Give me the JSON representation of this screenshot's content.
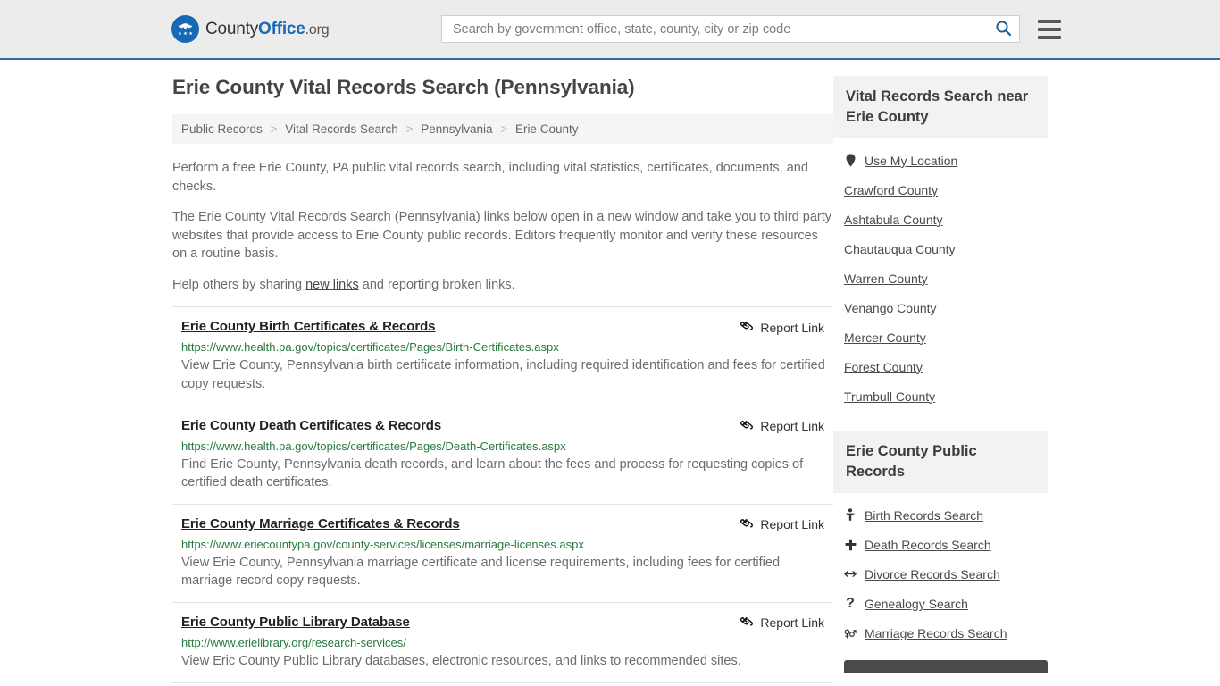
{
  "header": {
    "logo": {
      "icon": "eagle-seal-icon",
      "part1": "County",
      "part2": "Office",
      "part3": ".org"
    },
    "search": {
      "placeholder": "Search by government office, state, county, city or zip code",
      "value": "",
      "search_icon": "search-icon"
    },
    "menu_icon": "hamburger-menu-icon"
  },
  "main": {
    "title": "Erie County Vital Records Search (Pennsylvania)",
    "breadcrumb": [
      "Public Records",
      "Vital Records Search",
      "Pennsylvania",
      "Erie County"
    ],
    "breadcrumb_separator": ">",
    "intro_1": "Perform a free Erie County, PA public vital records search, including vital statistics, certificates, documents, and checks.",
    "intro_2": "The Erie County Vital Records Search (Pennsylvania) links below open in a new window and take you to third party websites that provide access to Erie County public records. Editors frequently monitor and verify these resources on a routine basis.",
    "intro_3_pre": "Help others by sharing ",
    "intro_3_link": "new links",
    "intro_3_post": " and reporting broken links.",
    "report_link_label": "Report Link",
    "report_link_icon": "broken-link-icon",
    "results": [
      {
        "title": "Erie County Birth Certificates & Records",
        "url": "https://www.health.pa.gov/topics/certificates/Pages/Birth-Certificates.aspx",
        "description": "View Erie County, Pennsylvania birth certificate information, including required identification and fees for certified copy requests."
      },
      {
        "title": "Erie County Death Certificates & Records",
        "url": "https://www.health.pa.gov/topics/certificates/Pages/Death-Certificates.aspx",
        "description": "Find Erie County, Pennsylvania death records, and learn about the fees and process for requesting copies of certified death certificates."
      },
      {
        "title": "Erie County Marriage Certificates & Records",
        "url": "https://www.eriecountypa.gov/county-services/licenses/marriage-licenses.aspx",
        "description": "View Erie County, Pennsylvania marriage certificate and license requirements, including fees for certified marriage record copy requests."
      },
      {
        "title": "Erie County Public Library Database",
        "url": "http://www.erielibrary.org/research-services/",
        "description": "View Eric County Public Library databases, electronic resources, and links to recommended sites."
      }
    ]
  },
  "sidebar": {
    "nearby_heading": "Vital Records Search near Erie County",
    "nearby_items": [
      {
        "label": "Use My Location",
        "icon": "map-pin-icon"
      },
      {
        "label": "Crawford County",
        "icon": ""
      },
      {
        "label": "Ashtabula County",
        "icon": ""
      },
      {
        "label": "Chautauqua County",
        "icon": ""
      },
      {
        "label": "Warren County",
        "icon": ""
      },
      {
        "label": "Venango County",
        "icon": ""
      },
      {
        "label": "Mercer County",
        "icon": ""
      },
      {
        "label": "Forest County",
        "icon": ""
      },
      {
        "label": "Trumbull County",
        "icon": ""
      }
    ],
    "records_heading": "Erie County Public Records",
    "records_items": [
      {
        "label": "Birth Records Search",
        "icon": "baby-icon",
        "glyph": "Ɔ"
      },
      {
        "label": "Death Records Search",
        "icon": "cross-icon",
        "glyph": "✚"
      },
      {
        "label": "Divorce Records Search",
        "icon": "double-arrow-icon",
        "glyph": "↔"
      },
      {
        "label": "Genealogy Search",
        "icon": "question-mark-icon",
        "glyph": "?"
      },
      {
        "label": "Marriage Records Search",
        "icon": "venus-mars-icon",
        "glyph": "⚥"
      }
    ]
  },
  "colors": {
    "brand_blue": "#1769b5",
    "header_border": "#2d6ca2",
    "url_green": "#2a7a3f",
    "header_bg": "#ececec"
  }
}
